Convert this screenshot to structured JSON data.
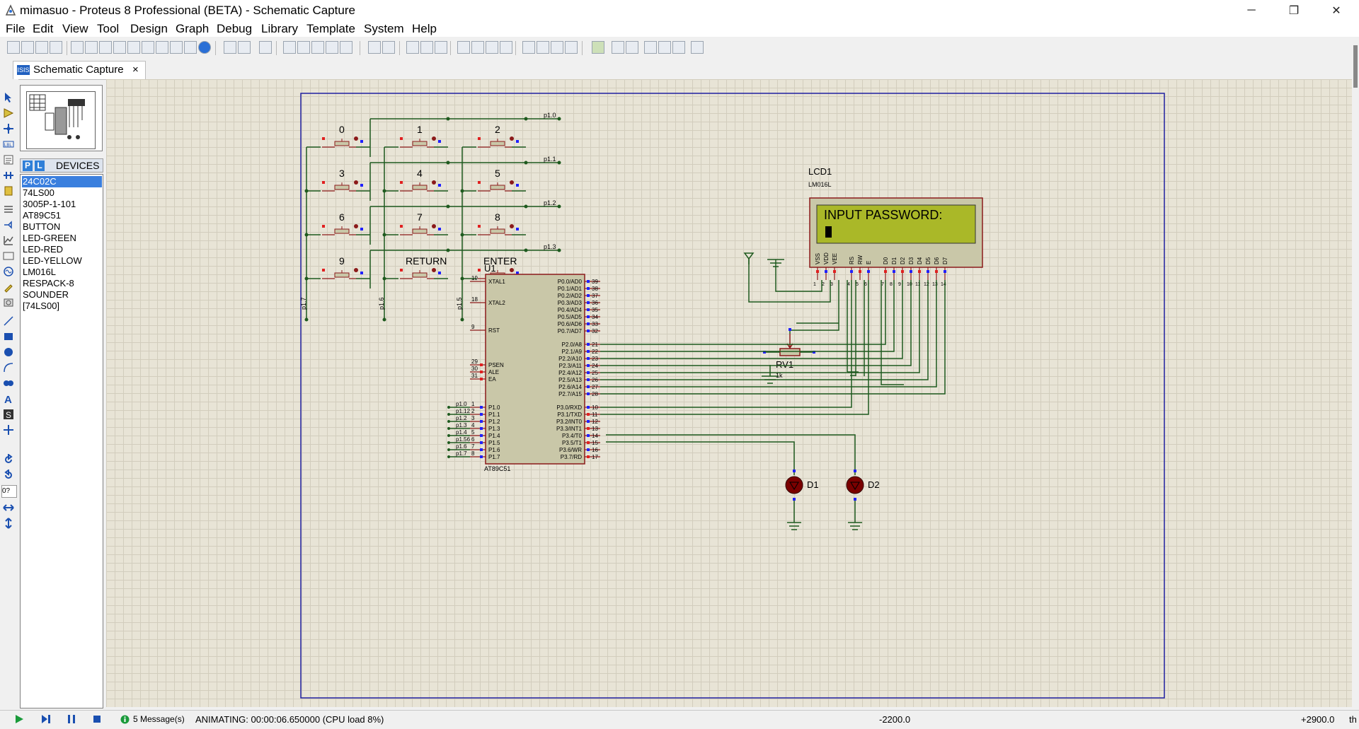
{
  "window": {
    "title": "mimasuo - Proteus 8 Professional (BETA) - Schematic Capture",
    "minimize": "─",
    "restore": "❐",
    "close": "✕"
  },
  "menu": [
    "File",
    "Edit",
    "View",
    "Tool",
    "Design",
    "Graph",
    "Debug",
    "Library",
    "Template",
    "System",
    "Help"
  ],
  "tab": {
    "label": "Schematic Capture",
    "close": "×",
    "icon": "ISIS"
  },
  "devices": {
    "p_label": "P",
    "l_label": "L",
    "title": "DEVICES",
    "items": [
      "24C02C",
      "74LS00",
      "3005P-1-101",
      "AT89C51",
      "BUTTON",
      "LED-GREEN",
      "LED-RED",
      "LED-YELLOW",
      "LM016L",
      "RESPACK-8",
      "SOUNDER",
      "[74LS00]"
    ],
    "selected_index": 0
  },
  "toolcol_zoom_label": "0?",
  "schematic": {
    "keys": [
      {
        "label": "0"
      },
      {
        "label": "1"
      },
      {
        "label": "2"
      },
      {
        "label": "3"
      },
      {
        "label": "4"
      },
      {
        "label": "5"
      },
      {
        "label": "6"
      },
      {
        "label": "7"
      },
      {
        "label": "8"
      },
      {
        "label": "9"
      },
      {
        "label": "RETURN"
      },
      {
        "label": "ENTER"
      }
    ],
    "row_nets": [
      "p1.0",
      "p1.1",
      "p1.2",
      "p1.3"
    ],
    "col_nets": [
      "p1.7",
      "p1.6",
      "p1.5"
    ],
    "lcd": {
      "ref": "LCD1",
      "part": "LM016L",
      "line1": "INPUT PASSWORD:",
      "line2": "",
      "pins": [
        "VSS",
        "VDD",
        "VEE",
        "RS",
        "RW",
        "E",
        "D0",
        "D1",
        "D2",
        "D3",
        "D4",
        "D5",
        "D6",
        "D7"
      ],
      "pin_numbers": [
        "1",
        "2",
        "3",
        "4",
        "5",
        "6",
        "7",
        "8",
        "9",
        "10",
        "11",
        "12",
        "13",
        "14"
      ]
    },
    "rv1": {
      "ref": "RV1",
      "value": "1k"
    },
    "mcu": {
      "ref": "U1",
      "part": "AT89C51",
      "left_pins": [
        {
          "num": "19",
          "name": "XTAL1"
        },
        {
          "num": "18",
          "name": "XTAL2"
        },
        {
          "num": "9",
          "name": "RST"
        },
        {
          "num": "29",
          "name": "PSEN"
        },
        {
          "num": "30",
          "name": "ALE"
        },
        {
          "num": "31",
          "name": "EA"
        },
        {
          "num": "1",
          "name": "P1.0"
        },
        {
          "num": "2",
          "name": "P1.1"
        },
        {
          "num": "3",
          "name": "P1.2"
        },
        {
          "num": "4",
          "name": "P1.3"
        },
        {
          "num": "5",
          "name": "P1.4"
        },
        {
          "num": "6",
          "name": "P1.5"
        },
        {
          "num": "7",
          "name": "P1.6"
        },
        {
          "num": "8",
          "name": "P1.7"
        }
      ],
      "port1_nets": [
        "p1.0",
        "p1.12",
        "p1.2",
        "p1.3",
        "p1.4",
        "p1.56",
        "p1.6",
        "p1.7"
      ],
      "right_pins": [
        {
          "num": "39",
          "name": "P0.0/AD0"
        },
        {
          "num": "38",
          "name": "P0.1/AD1"
        },
        {
          "num": "37",
          "name": "P0.2/AD2"
        },
        {
          "num": "36",
          "name": "P0.3/AD3"
        },
        {
          "num": "35",
          "name": "P0.4/AD4"
        },
        {
          "num": "34",
          "name": "P0.5/AD5"
        },
        {
          "num": "33",
          "name": "P0.6/AD6"
        },
        {
          "num": "32",
          "name": "P0.7/AD7"
        },
        {
          "num": "21",
          "name": "P2.0/A8"
        },
        {
          "num": "22",
          "name": "P2.1/A9"
        },
        {
          "num": "23",
          "name": "P2.2/A10"
        },
        {
          "num": "24",
          "name": "P2.3/A11"
        },
        {
          "num": "25",
          "name": "P2.4/A12"
        },
        {
          "num": "26",
          "name": "P2.5/A13"
        },
        {
          "num": "27",
          "name": "P2.6/A14"
        },
        {
          "num": "28",
          "name": "P2.7/A15"
        },
        {
          "num": "10",
          "name": "P3.0/RXD"
        },
        {
          "num": "11",
          "name": "P3.1/TXD"
        },
        {
          "num": "12",
          "name": "P3.2/INT0"
        },
        {
          "num": "13",
          "name": "P3.3/INT1"
        },
        {
          "num": "14",
          "name": "P3.4/T0"
        },
        {
          "num": "15",
          "name": "P3.5/T1"
        },
        {
          "num": "16",
          "name": "P3.6/WR"
        },
        {
          "num": "17",
          "name": "P3.7/RD"
        }
      ]
    },
    "leds": [
      {
        "ref": "D1"
      },
      {
        "ref": "D2"
      }
    ]
  },
  "status": {
    "messages": "5 Message(s)",
    "animating": "ANIMATING: 00:00:06.650000 (CPU load 8%)",
    "x_coord": "-2200.0",
    "y_coord": "+2900.0",
    "units": "th"
  },
  "colors": {
    "canvas": "#e8e4d6",
    "wire": "#1e5a1e",
    "component": "#8b1a1a",
    "mcu_fill": "#c9c7a8",
    "lcd_screen": "#aab828",
    "sheet_border": "#2020a0",
    "pin_red": "#e02020",
    "pin_blue": "#2020ff"
  }
}
